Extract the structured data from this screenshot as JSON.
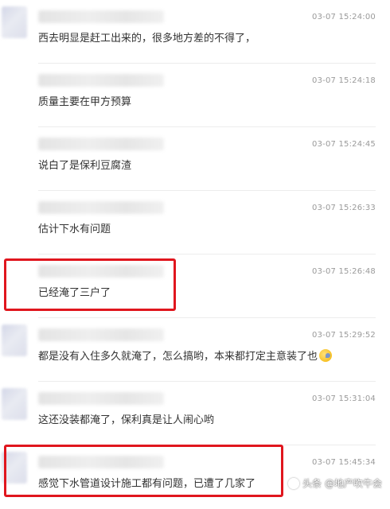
{
  "comments": [
    {
      "time": "03-07 15:24:00",
      "text": "西去明显是赶工出来的，很多地方差的不得了，",
      "highlighted": false
    },
    {
      "time": "03-07 15:24:18",
      "text": "质量主要在甲方预算",
      "highlighted": false
    },
    {
      "time": "03-07 15:24:45",
      "text": "说白了是保利豆腐渣",
      "highlighted": false
    },
    {
      "time": "03-07 15:26:33",
      "text": "估计下水有问题",
      "highlighted": false
    },
    {
      "time": "03-07 15:26:48",
      "text": "已经淹了三户了",
      "highlighted": true
    },
    {
      "time": "03-07 15:29:52",
      "text": "都是没有入住多久就淹了，怎么搞哟，本来都打定主意装了也",
      "highlighted": false,
      "emoji": "emoji-icon"
    },
    {
      "time": "03-07 15:31:04",
      "text": "这还没装都淹了，保利真是让人闹心哟",
      "highlighted": false
    },
    {
      "time": "03-07 15:45:34",
      "text": "感觉下水管道设计施工都有问题，已遭了几家了",
      "highlighted": true
    }
  ],
  "watermark": {
    "text": "头条 @地产吹牛会"
  },
  "colors": {
    "highlight": "#e0161e",
    "time": "#9a9a9a",
    "text": "#333333"
  }
}
